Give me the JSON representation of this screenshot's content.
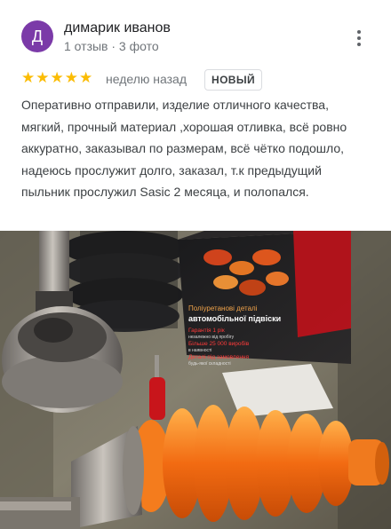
{
  "review": {
    "avatar_letter": "Д",
    "author": "димарик иванов",
    "author_meta": "1 отзыв · 3 фото",
    "rating": 5,
    "stars": "★★★★★",
    "time": "неделю назад",
    "badge": "НОВЫЙ",
    "text": "Оперативно отправили, изделие отличного качества, мягкий, прочный материал ,хорошая отливка, всё ровно аккуратно, заказывал по размерам, всё чётко подошло, надеюсь прослужит долго, заказал, т.к предыдущий пыльник прослужил Sasic 2 месяца, и полопался."
  },
  "photo": {
    "box_heading_1": "Поліуретанові деталі",
    "box_heading_2": "автомобільної підвіски",
    "box_line_1": "Гарантія 1 рік",
    "box_line_2": "незалежно від пробігу",
    "box_line_3": "Більше 25 000 виробів",
    "box_line_4": "в наявності",
    "box_line_5": "Деталі під замовлення",
    "box_line_6": "будь-якої складності"
  },
  "colors": {
    "avatar": "#7b3aa8",
    "star": "#fbbc04",
    "boot_orange": "#f26b12",
    "box_red": "#c0121b"
  },
  "icons": {
    "more": "more-vertical-icon",
    "star": "star-icon"
  }
}
